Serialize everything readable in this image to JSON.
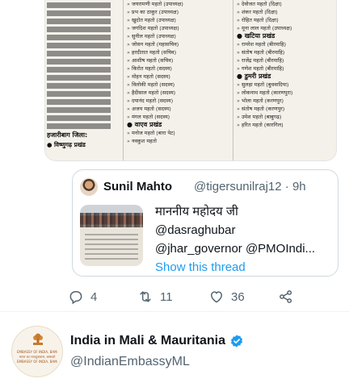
{
  "newspaper": {
    "column_b": {
      "items": [
        "जयरामणी महतो (उपाध्यक्ष)",
        "प्रभ का ठाकुर (उपाध्यक्ष)",
        "खुदोत महतो (उपाध्यक्ष)",
        "जगदिश महतो (उपाध्यक्ष)",
        "सुनील महतो (उपाध्यक्ष)",
        "जोसन महतो (महासचिव)",
        "हरदीतात महतो (सचिव)",
        "आशीष महतो (सचिव)",
        "किरोत महतो (सदस्य)",
        "मोहन महतो (सदस्य)",
        "विलोकी महतो (सदस्य)",
        "हैदीसाल महतो (सदस्य)",
        "दयानंद महतो (सदस्य)",
        "अजय महतो (सदस्य)",
        "मंगल महतो (सदस्य)"
      ],
      "section_heading": "● वाएव प्रखंड",
      "section_items": [
        "मनोज महतो (बारा पेट)",
        "नवकुश महतो"
      ]
    },
    "column_c": {
      "items": [
        "देवोजत महतो (दिक्षा)",
        "शंकर महतो (दिक्षा)",
        "रोहित महतो (दिक्षा)",
        "मूना लाल महतो (उपाध्यक्ष)"
      ],
      "heading_1": "● खटिया प्रखंड",
      "items_1": [
        "रामरेश महतो (बीरमाहि)",
        "संतोष महतो (बीरमाहि)",
        "राजेंद्र महतो (बीरमाहि)",
        "गणेश महतो (बीरमाहि)"
      ],
      "heading_2": "● डुमरी प्रखंड",
      "items_2": [
        "सुलहा महतो (बुधवादिया)",
        "लोकनाथ महतो (कारणपुरा)",
        "भोला महतो (करणपुर)",
        "संतोष महतो (करणपुर)",
        "उमेश महतो (बाबुगढ़)",
        "हरित महतो (कारगिल)"
      ]
    },
    "column_a": {
      "bottom_heading": "हजारीबाग जिला:",
      "sub_heading": "● विष्णुगढ़ प्रखंड"
    }
  },
  "quoted_tweet": {
    "name": "Sunil Mahto",
    "handle_time": "@tigersunilraj12 · 9h",
    "lines": [
      "माननीय महोदय जी",
      "@dasraghubar",
      "@jhar_governor @PMOIndi..."
    ],
    "show_thread": "Show this thread"
  },
  "actions": {
    "reply_count": "4",
    "retweet_count": "11",
    "like_count": "36",
    "icons": [
      "reply-icon",
      "retweet-icon",
      "like-icon",
      "share-icon"
    ],
    "color": "#536471"
  },
  "next_tweet": {
    "name": "India in Mali & Mauritania",
    "handle": "@IndianEmbassyML",
    "verified": true,
    "avatar_text": [
      "EMBASSY OF INDIA, BAMAKO",
      "भारत का राजदूतावास, बामाको",
      "EMBASSY OF INDIA, BAMAKO"
    ]
  },
  "colors": {
    "accent": "#1d9bf0",
    "text": "#0f1419",
    "secondary": "#536471",
    "border": "#cfd9de"
  }
}
